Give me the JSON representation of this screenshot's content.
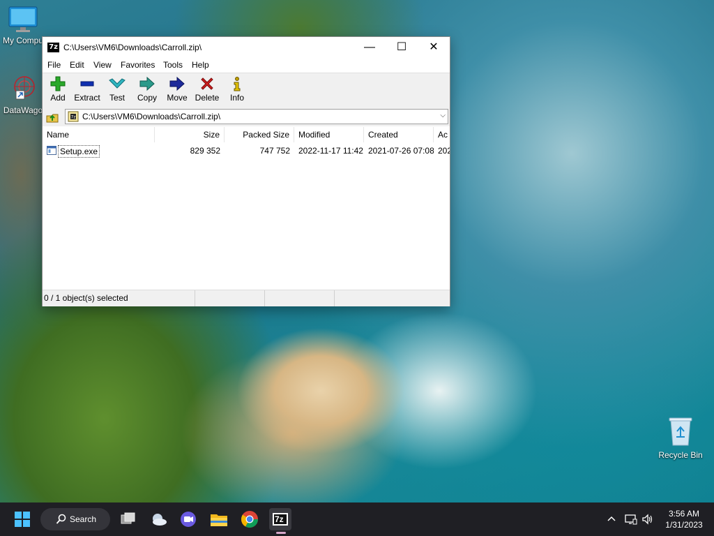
{
  "desktop": {
    "icons": [
      {
        "label": "My Compu"
      },
      {
        "label": "DataWago"
      },
      {
        "label": "Recycle Bin"
      }
    ]
  },
  "window": {
    "app_icon_text": "7z",
    "title": "C:\\Users\\VM6\\Downloads\\Carroll.zip\\",
    "controls": {
      "minimize": "—",
      "maximize": "☐",
      "close": "✕"
    }
  },
  "menu": [
    "File",
    "Edit",
    "View",
    "Favorites",
    "Tools",
    "Help"
  ],
  "toolbar": {
    "add": "Add",
    "extract": "Extract",
    "test": "Test",
    "copy": "Copy",
    "move": "Move",
    "delete": "Delete",
    "info": "Info",
    "colors": {
      "add": "#2aa82a",
      "extract": "#1030b0",
      "test": "#2fb5c0",
      "copy": "#2b9a8a",
      "move": "#1d2a9a",
      "delete": "#d02020",
      "info": "#c0a000"
    }
  },
  "address": {
    "path": "C:\\Users\\VM6\\Downloads\\Carroll.zip\\"
  },
  "list": {
    "columns": [
      "Name",
      "Size",
      "Packed Size",
      "Modified",
      "Created",
      "Ac"
    ],
    "rows": [
      {
        "name": "Setup.exe",
        "size": "829 352",
        "packed": "747 752",
        "modified": "2022-11-17 11:42",
        "created": "2021-07-26 07:08",
        "accessed": "202"
      }
    ]
  },
  "status": {
    "selection": "0 / 1 object(s) selected"
  },
  "taskbar": {
    "search_label": "Search",
    "active_app": "7z",
    "clock_time": "3:56 AM",
    "clock_date": "1/31/2023"
  }
}
